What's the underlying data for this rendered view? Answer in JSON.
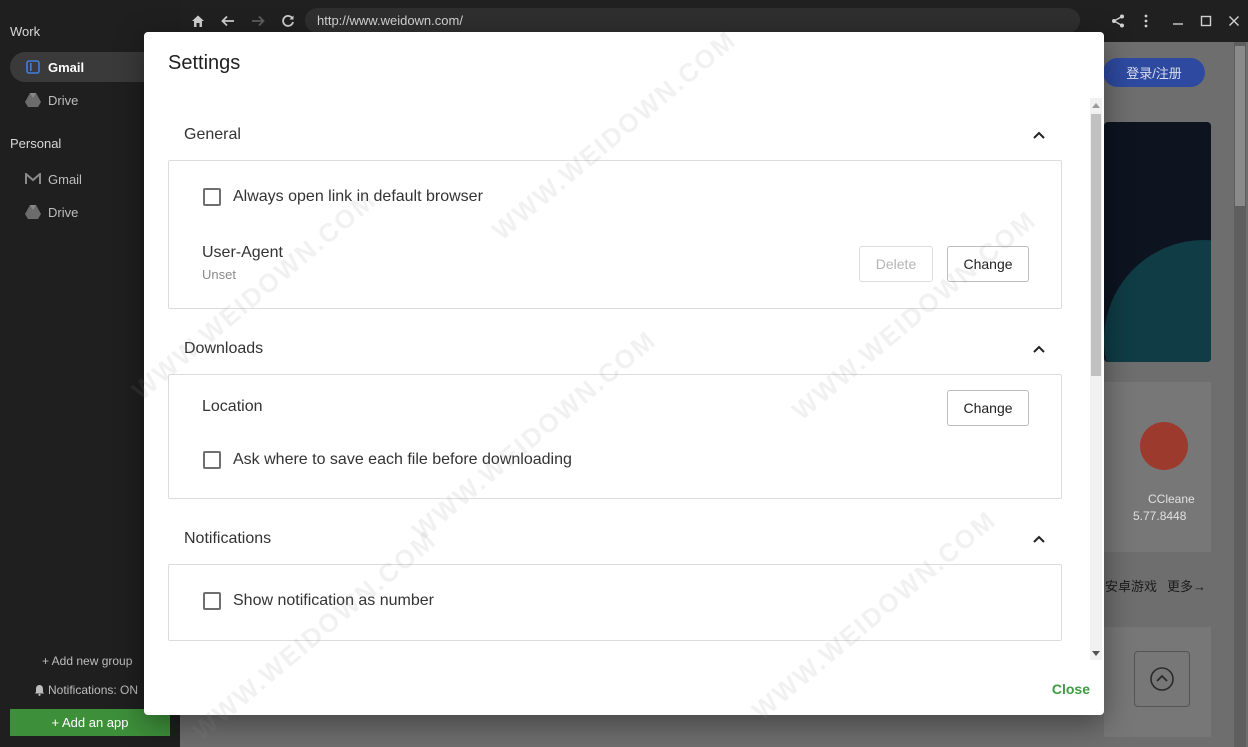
{
  "sidebar": {
    "work_title": "Work",
    "personal_title": "Personal",
    "work_items": [
      {
        "label": "Gmail",
        "icon": "gmail-icon"
      },
      {
        "label": "Drive",
        "icon": "drive-icon"
      }
    ],
    "personal_items": [
      {
        "label": "Gmail",
        "icon": "gmail-icon"
      },
      {
        "label": "Drive",
        "icon": "drive-icon"
      }
    ],
    "add_group": "+ Add new group",
    "notifications": "Notifications: ON",
    "add_app": "+ Add an app"
  },
  "topbar": {
    "url": "http://www.weidown.com/"
  },
  "background": {
    "login_button": "登录/注册",
    "app_name": "CCleane",
    "app_version": "5.77.8448",
    "link1": "安卓游戏",
    "link2": "更多→"
  },
  "dialog": {
    "title": "Settings",
    "general": {
      "heading": "General",
      "always_open_link": "Always open link in default browser",
      "user_agent_label": "User-Agent",
      "user_agent_value": "Unset",
      "delete_label": "Delete",
      "change_label": "Change"
    },
    "downloads": {
      "heading": "Downloads",
      "location_label": "Location",
      "change_label": "Change",
      "ask_where": "Ask where to save each file before downloading"
    },
    "notifications": {
      "heading": "Notifications",
      "show_as_number": "Show notification as number"
    },
    "close_label": "Close"
  },
  "watermark": "WWW.WEIDOWN.COM",
  "colors": {
    "accent_green": "#3d9b42",
    "add_app_green": "#3d8f3a",
    "login_blue": "#2e4aa0"
  }
}
